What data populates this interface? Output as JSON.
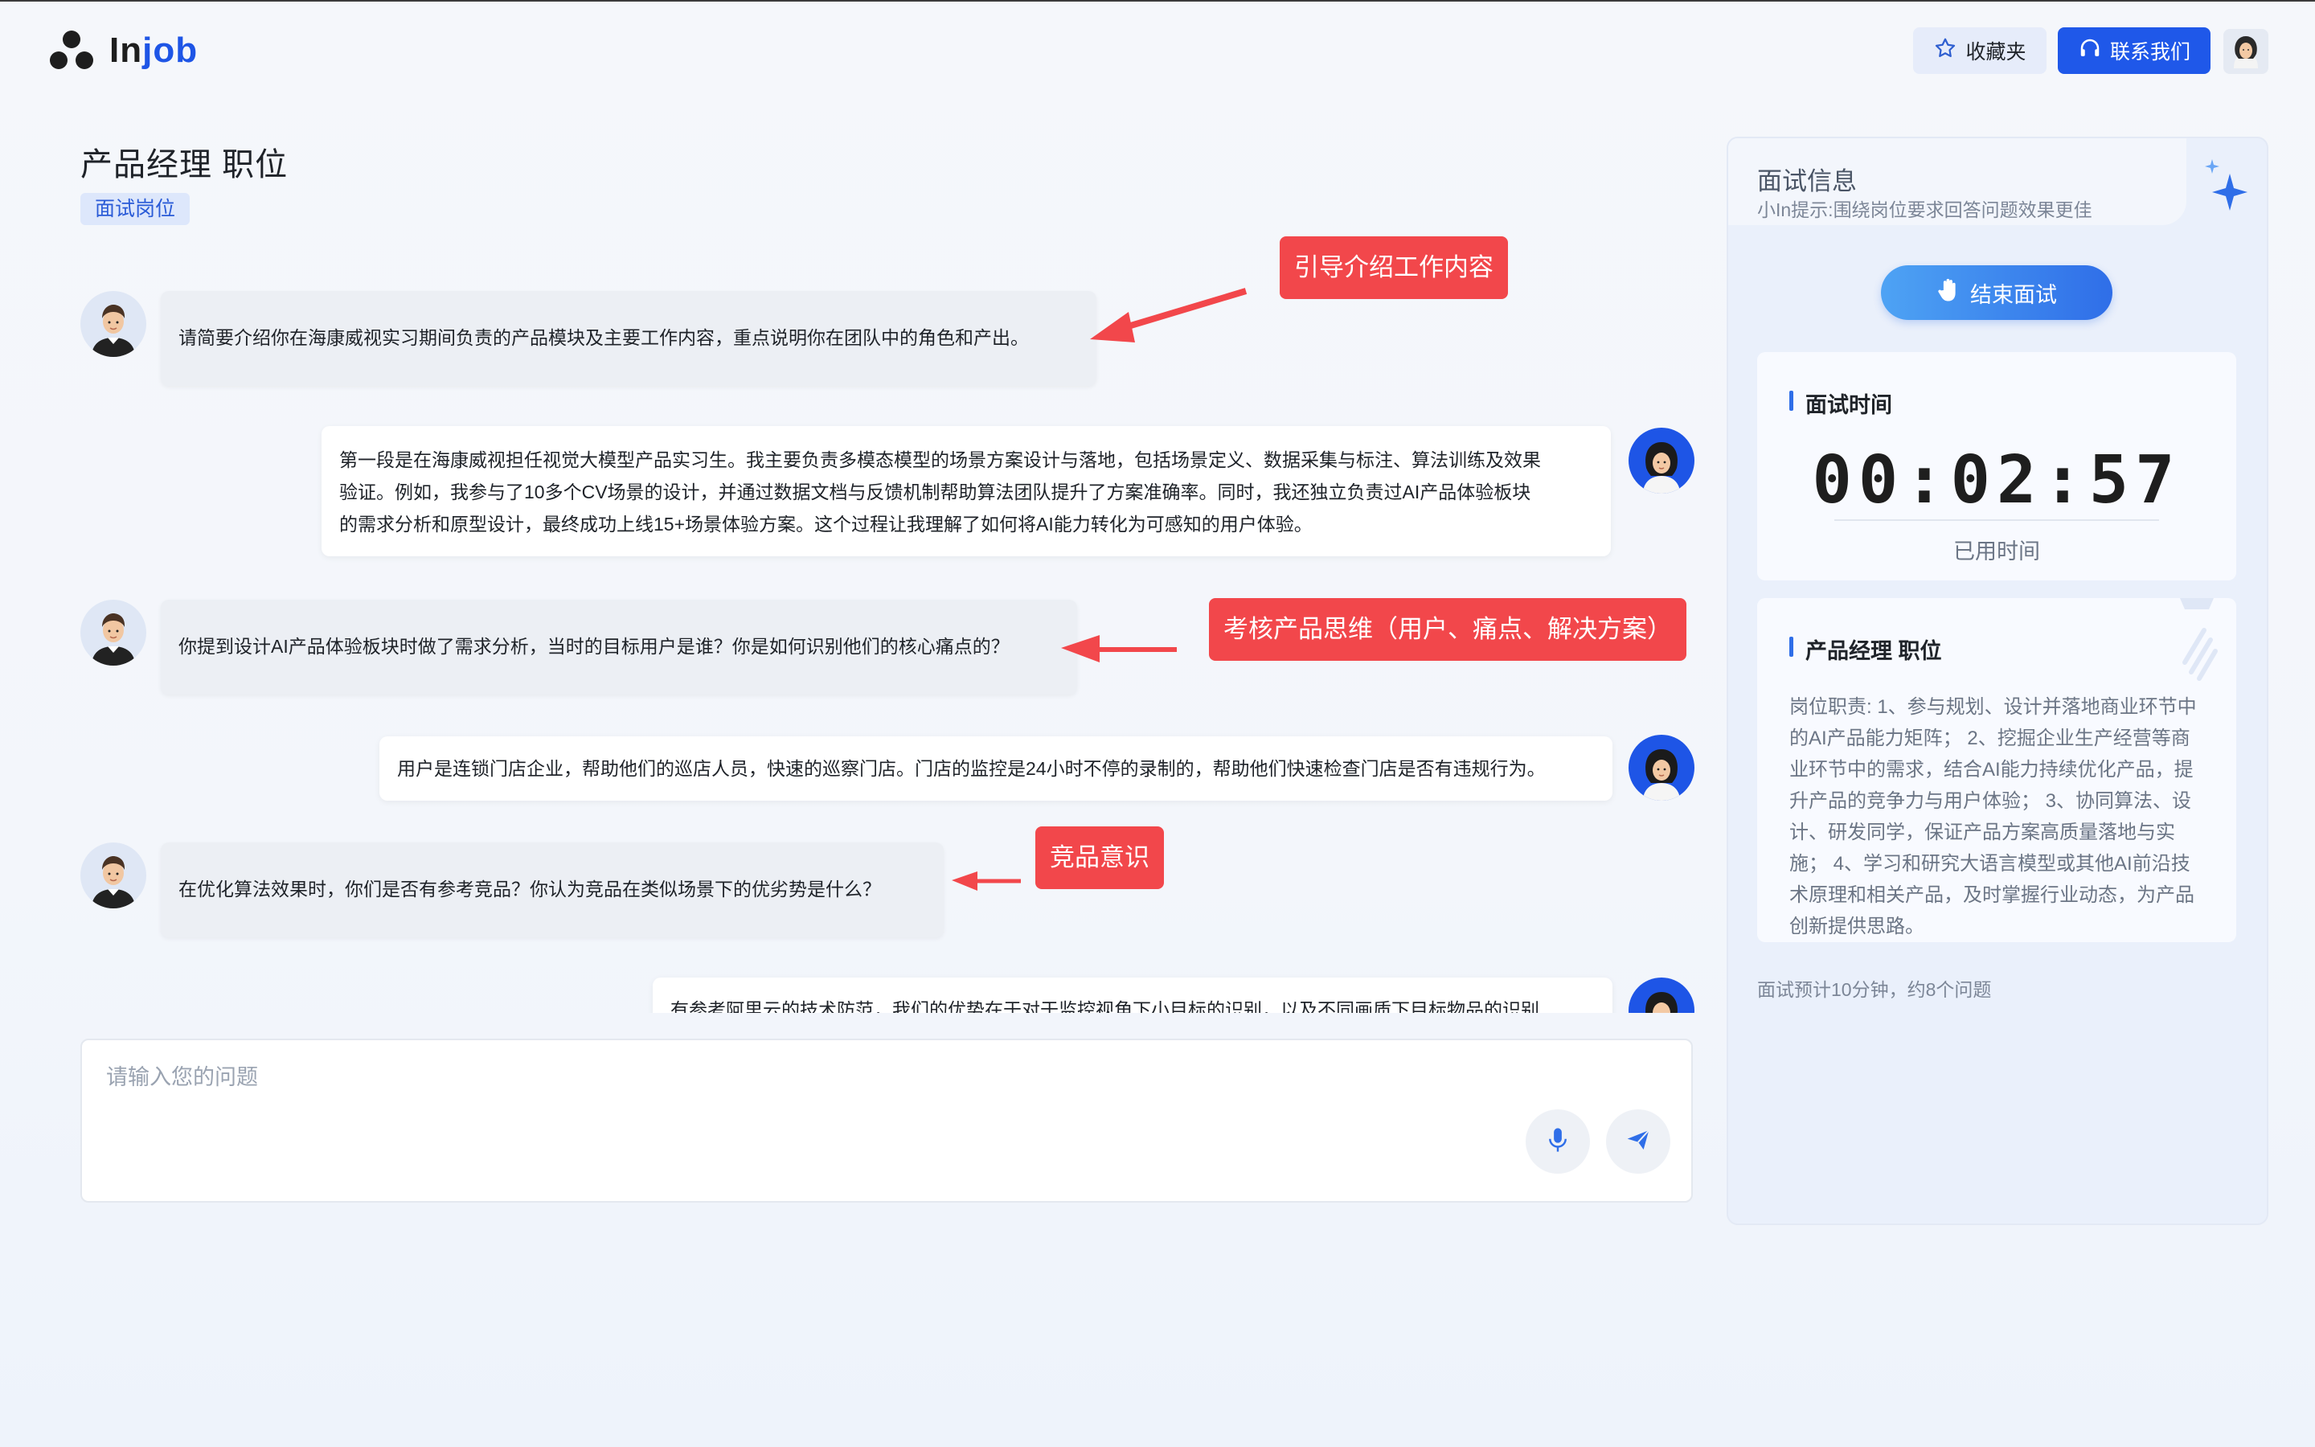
{
  "header": {
    "logo_a": "In",
    "logo_b": "job",
    "favorites_label": "收藏夹",
    "contact_label": "联系我们"
  },
  "page": {
    "title": "产品经理 职位",
    "tag": "面试岗位"
  },
  "chat": {
    "messages": [
      {
        "role": "interviewer",
        "text": "请简要介绍你在海康威视实习期间负责的产品模块及主要工作内容，重点说明你在团队中的角色和产出。"
      },
      {
        "role": "candidate",
        "lines": [
          "第一段是在海康威视担任视觉大模型产品实习生。我主要负责多模态模型的场景方案设计与落地，包括场景定义、数据采集与标注、算法训练及效果",
          "验证。例如，我参与了10多个CV场景的设计，并通过数据文档与反馈机制帮助算法团队提升了方案准确率。同时，我还独立负责过AI产品体验板块",
          "的需求分析和原型设计，最终成功上线15+场景体验方案。这个过程让我理解了如何将AI能力转化为可感知的用户体验。"
        ]
      },
      {
        "role": "interviewer",
        "text": "你提到设计AI产品体验板块时做了需求分析，当时的目标用户是谁？你是如何识别他们的核心痛点的？"
      },
      {
        "role": "candidate",
        "text": "用户是连锁门店企业，帮助他们的巡店人员，快速的巡察门店。门店的监控是24小时不停的录制的，帮助他们快速检查门店是否有违规行为。"
      },
      {
        "role": "interviewer",
        "text": "在优化算法效果时，你们是否有参考竞品？你认为竞品在类似场景下的优劣势是什么？"
      },
      {
        "role": "candidate",
        "text": "有参考阿里云的技术防范，我们的优势在于对于监控视角下小目标的识别，以及不同画质下目标物品的识别"
      }
    ]
  },
  "annotations": [
    {
      "label": "引导介绍工作内容"
    },
    {
      "label": "考核产品思维（用户、痛点、解决方案）"
    },
    {
      "label": "竞品意识"
    }
  ],
  "input": {
    "placeholder": "请输入您的问题"
  },
  "panel": {
    "title": "面试信息",
    "hint": "小In提示:围绕岗位要求回答问题效果更佳",
    "end_button": "结束面试",
    "time_heading": "面试时间",
    "timer": "00:02:57",
    "timer_sub": "已用时间",
    "job_heading": "产品经理 职位",
    "job_desc": "岗位职责: 1、参与规划、设计并落地商业环节中的AI产品能力矩阵； 2、挖掘企业生产经营等商业环节中的需求，结合AI能力持续优化产品，提升产品的竞争力与用户体验； 3、协同算法、设计、研发同学，保证产品方案高质量落地与实施； 4、学习和研究大语言模型或其他AI前沿技术原理和相关产品，及时掌握行业动态，为产品创新提供思路。",
    "footer": "面试预计10分钟，约8个问题"
  },
  "colors": {
    "primary": "#1f58e9",
    "annotation": "#f2474b",
    "tag_bg": "#dde7fb"
  },
  "icons": [
    "star-icon",
    "headset-icon",
    "mic-icon",
    "send-icon",
    "hand-icon",
    "sparkle-icon"
  ]
}
